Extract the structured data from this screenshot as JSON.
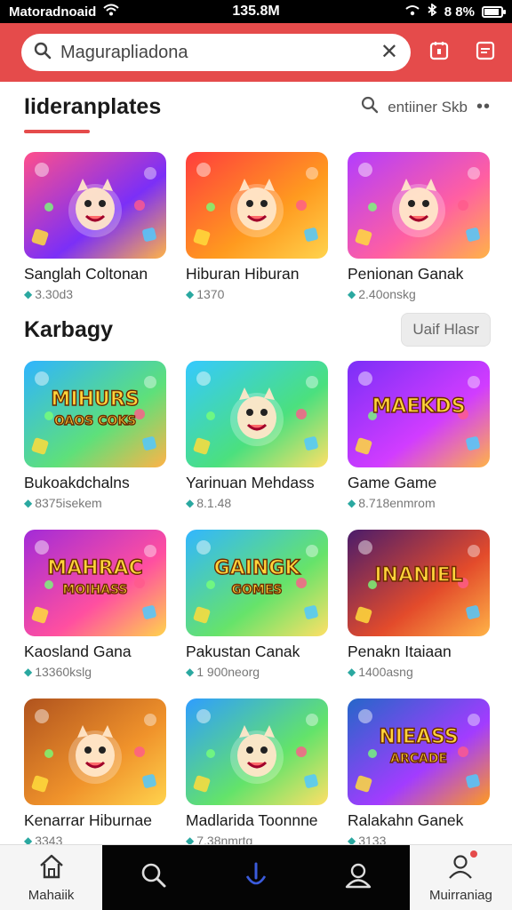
{
  "status_bar": {
    "carrier": "Matoradnoaid",
    "time": "135.8M",
    "battery": "8 8%"
  },
  "search": {
    "value": "Magurapliadona",
    "clear_label": "✕"
  },
  "section1": {
    "title": "Iideranplates",
    "action_label": "entiiner Skb",
    "more_label": "••"
  },
  "section2": {
    "title": "Karbagy",
    "button_label": "Uaif Hlasr"
  },
  "cards": [
    {
      "title": "Sanglah Coltonan",
      "sub": "3.30d3",
      "art": "red-creature"
    },
    {
      "title": "Hiburan Hiburan",
      "sub": "1370",
      "art": "wolf-sunburst"
    },
    {
      "title": "Penionan Ganak",
      "sub": "2.40onskg",
      "art": "lion-purple"
    },
    {
      "title": "Bukoakdchalns",
      "sub": "8375isekem",
      "art": "candy-logo"
    },
    {
      "title": "Yarinuan Mehdass",
      "sub": "8.1.48",
      "art": "cat-meadow"
    },
    {
      "title": "Game Game",
      "sub": "8.718enmrom",
      "art": "blue-monster"
    },
    {
      "title": "Kaosland Gana",
      "sub": "13360kslg",
      "art": "purple-logo"
    },
    {
      "title": "Pakustan Canak",
      "sub": "1 900neorg",
      "art": "gaming-games"
    },
    {
      "title": "Penakn Itaiaan",
      "sub": "1400asng",
      "art": "orange-logo"
    },
    {
      "title": "Kenarrar Hiburnae",
      "sub": "3343",
      "art": "bear-brown"
    },
    {
      "title": "Madlarida Toonnne",
      "sub": "7.38nmrtg",
      "art": "green-dino"
    },
    {
      "title": "Ralakahn Ganek",
      "sub": "3133",
      "art": "neass-logo"
    }
  ],
  "card_logo_texts": {
    "candy-logo": [
      "MIHURS",
      "OAOS COKS"
    ],
    "purple-logo": [
      "MAHRAC",
      "MOIHASS"
    ],
    "gaming-games": [
      "GAINGK",
      "GOMES"
    ],
    "orange-logo": [
      "INANIEL"
    ],
    "neass-logo": [
      "NIEASS",
      "ARCADE"
    ],
    "blue-monster": [
      "MAEKDS"
    ]
  },
  "bottom_nav": [
    {
      "label": "Mahaiik",
      "icon": "home-icon"
    },
    {
      "label": "",
      "icon": "search-icon"
    },
    {
      "label": "",
      "icon": "microphone-icon"
    },
    {
      "label": "",
      "icon": "profile-icon"
    },
    {
      "label": "Muirraniag",
      "icon": "account-icon"
    }
  ],
  "colors": {
    "accent": "#e54b4b",
    "mic_blue": "#3b5bdb",
    "download_teal": "#2aa8a0"
  }
}
